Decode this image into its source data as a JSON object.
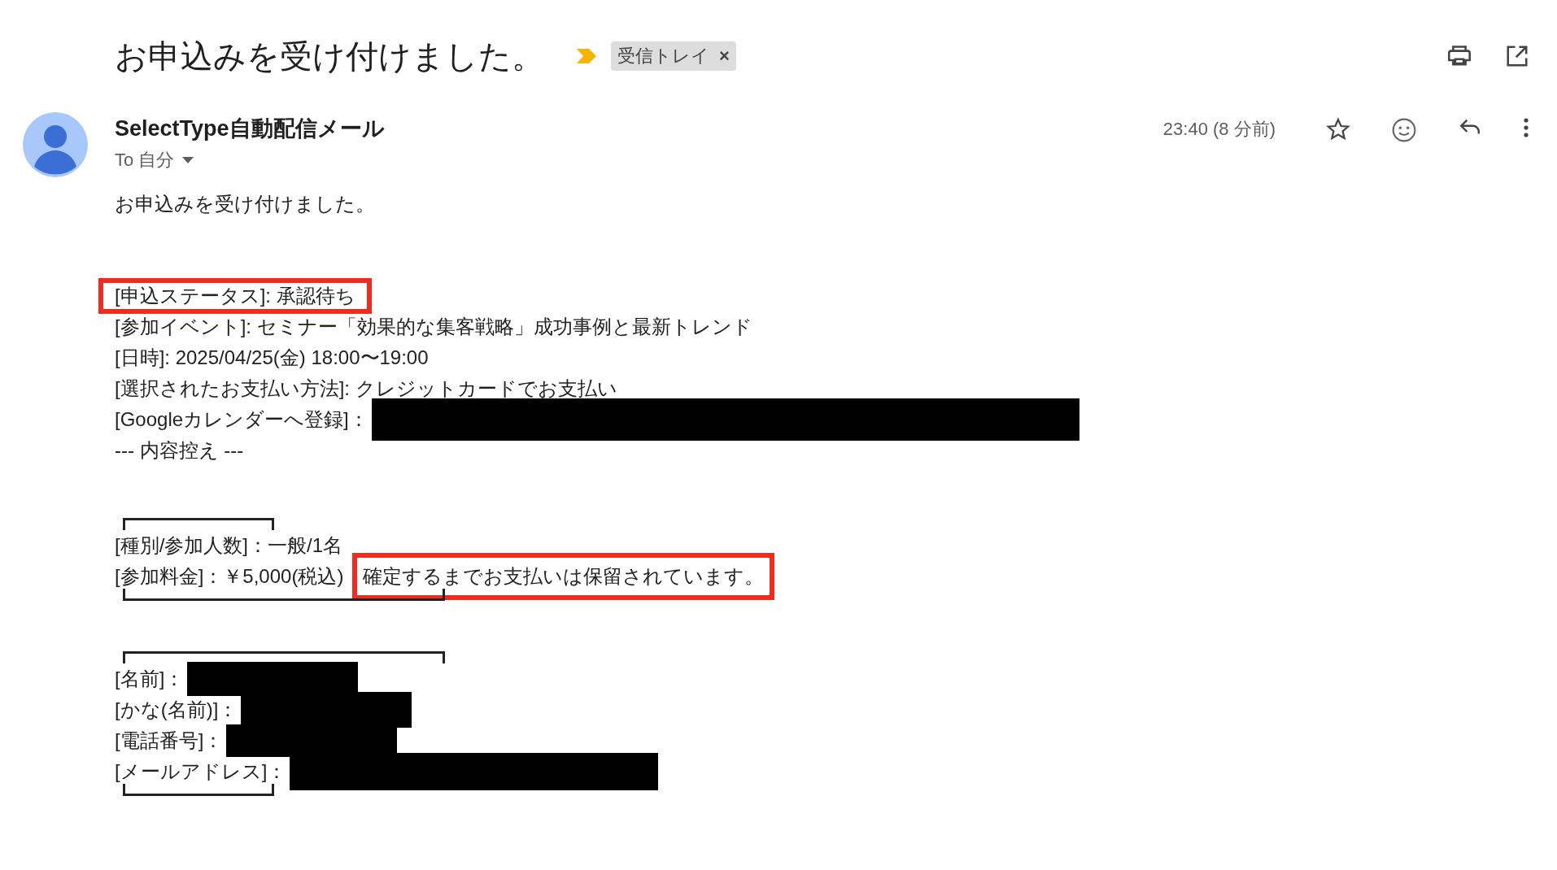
{
  "header": {
    "subject": "お申込みを受け付けました。",
    "important": true,
    "labels": [
      {
        "text": "受信トレイ",
        "close": "×"
      }
    ]
  },
  "message": {
    "sender": "SelectType自動配信メール",
    "recipient": "To 自分",
    "time": "23:40 (8 分前)",
    "starred": false
  },
  "body": {
    "intro": "お申込みを受け付けました。",
    "sections": [
      {
        "kind": "plain",
        "lines": [
          {
            "text": "[申込ステータス]: 承認待ち",
            "highlighted": true,
            "redacted": false
          },
          {
            "text": "[参加イベント]: セミナー「効果的な集客戦略」成功事例と最新トレンド",
            "highlighted": false,
            "redacted": false
          },
          {
            "text": "[日時]: 2025/04/25(金) 18:00〜19:00",
            "highlighted": false,
            "redacted": false
          },
          {
            "text": "[選択されたお支払い方法]: クレジットカードでお支払い",
            "highlighted": false,
            "redacted": false
          },
          {
            "text": "[Googleカレンダーへ登録]：",
            "highlighted": false,
            "redacted": true
          },
          {
            "text": "--- 内容控え ---",
            "highlighted": false,
            "redacted": false
          }
        ]
      },
      {
        "kind": "bracketed",
        "lines": [
          {
            "text": "[種別/参加人数]：一般/1名",
            "highlighted": false,
            "redacted": false
          },
          {
            "text": "[参加料金]：￥5,000(税込)",
            "highlighted": false,
            "redacted": false,
            "note": {
              "text": "確定するまでお支払いは保留されています。",
              "highlighted": true
            }
          }
        ]
      },
      {
        "kind": "bracketed",
        "lines": [
          {
            "text": "[名前]：",
            "highlighted": false,
            "redacted": true
          },
          {
            "text": "[かな(名前)]：",
            "highlighted": false,
            "redacted": true
          },
          {
            "text": "[電話番号]：",
            "highlighted": false,
            "redacted": true
          },
          {
            "text": "[メールアドレス]：",
            "highlighted": false,
            "redacted": true
          }
        ]
      }
    ]
  }
}
